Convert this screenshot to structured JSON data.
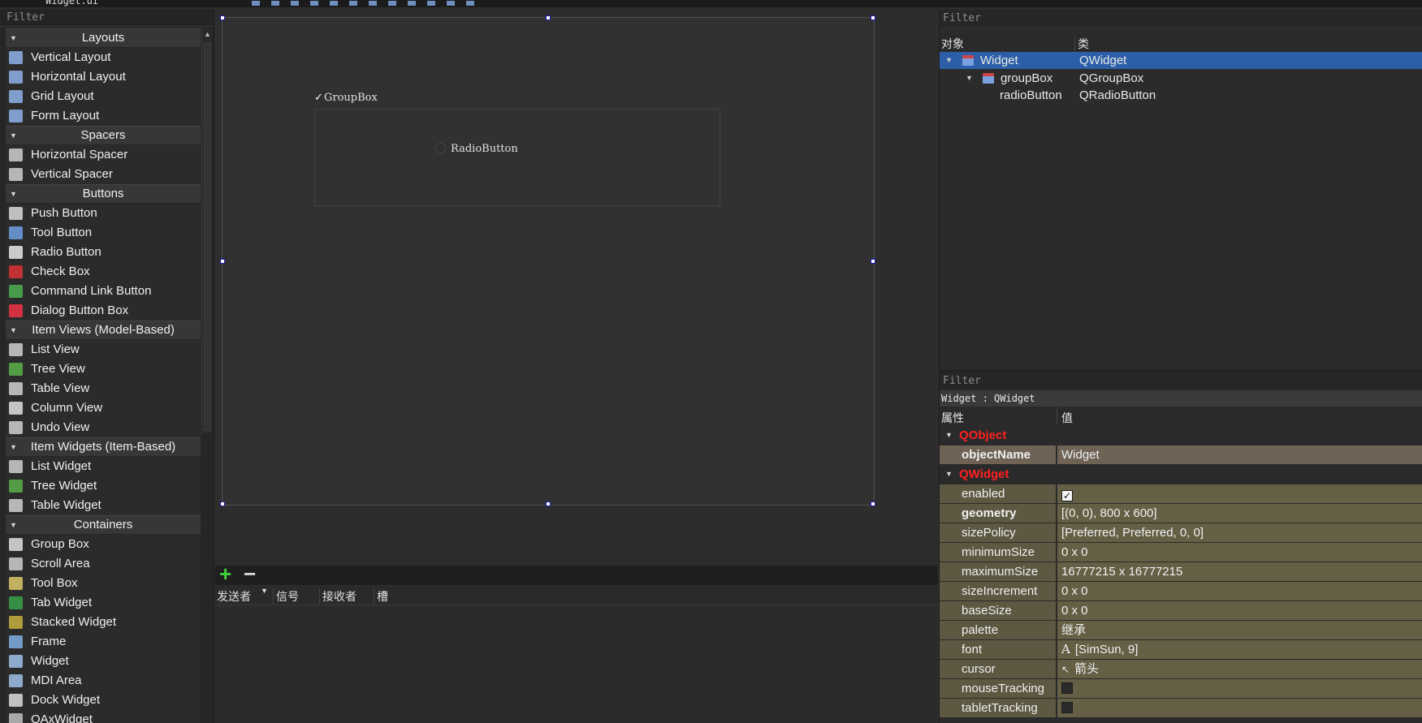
{
  "toolbar": {
    "file_name": "Widget.ui"
  },
  "widget_box": {
    "filter_placeholder": "Filter",
    "categories": [
      {
        "label": "Layouts",
        "items": [
          "Vertical Layout",
          "Horizontal Layout",
          "Grid Layout",
          "Form Layout"
        ]
      },
      {
        "label": "Spacers",
        "items": [
          "Horizontal Spacer",
          "Vertical Spacer"
        ]
      },
      {
        "label": "Buttons",
        "items": [
          "Push Button",
          "Tool Button",
          "Radio Button",
          "Check Box",
          "Command Link Button",
          "Dialog Button Box"
        ]
      },
      {
        "label": "Item Views (Model-Based)",
        "items": [
          "List View",
          "Tree View",
          "Table View",
          "Column View",
          "Undo View"
        ]
      },
      {
        "label": "Item Widgets (Item-Based)",
        "items": [
          "List Widget",
          "Tree Widget",
          "Table Widget"
        ]
      },
      {
        "label": "Containers",
        "items": [
          "Group Box",
          "Scroll Area",
          "Tool Box",
          "Tab Widget",
          "Stacked Widget",
          "Frame",
          "Widget",
          "MDI Area",
          "Dock Widget",
          "QAxWidget"
        ]
      }
    ]
  },
  "form": {
    "groupbox_title": "GroupBox",
    "groupbox_check": "✓",
    "radio_label": "RadioButton"
  },
  "signal_slot": {
    "add": "+",
    "remove": "−",
    "columns": [
      "发送者",
      "信号",
      "接收者",
      "槽"
    ]
  },
  "object_inspector": {
    "filter_placeholder": "Filter",
    "col_object": "对象",
    "col_class": "类",
    "rows": [
      {
        "name": "Widget",
        "class": "QWidget"
      },
      {
        "name": "groupBox",
        "class": "QGroupBox"
      },
      {
        "name": "radioButton",
        "class": "QRadioButton"
      }
    ]
  },
  "property_editor": {
    "filter_placeholder": "Filter",
    "object_class": "Widget : QWidget",
    "col_property": "属性",
    "col_value": "值",
    "group_qobject": "QObject",
    "object_name_key": "objectName",
    "object_name_value": "Widget",
    "group_qwidget": "QWidget",
    "props": [
      {
        "key": "enabled",
        "value": "✓"
      },
      {
        "key": "geometry",
        "value": "[(0, 0), 800 x 600]"
      },
      {
        "key": "sizePolicy",
        "value": "[Preferred, Preferred, 0, 0]"
      },
      {
        "key": "minimumSize",
        "value": "0 x 0"
      },
      {
        "key": "maximumSize",
        "value": "16777215 x 16777215"
      },
      {
        "key": "sizeIncrement",
        "value": "0 x 0"
      },
      {
        "key": "baseSize",
        "value": "0 x 0"
      },
      {
        "key": "palette",
        "value": "继承"
      },
      {
        "key": "font",
        "value": "[SimSun, 9]"
      },
      {
        "key": "cursor",
        "value": "箭头"
      },
      {
        "key": "mouseTracking",
        "value": ""
      },
      {
        "key": "tabletTracking",
        "value": ""
      }
    ]
  },
  "colors": {
    "selection": "#2c5fa8",
    "group_header": "#ff2020",
    "add_green": "#3fd13a"
  }
}
